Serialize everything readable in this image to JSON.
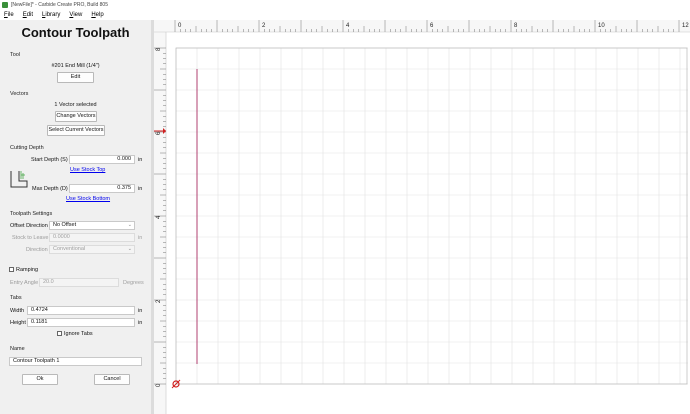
{
  "window": {
    "title": "[NewFile]* - Carbide Create PRO, Build 805"
  },
  "menu": [
    "File",
    "Edit",
    "Library",
    "View",
    "Help"
  ],
  "panel": {
    "heading": "Contour Toolpath",
    "tool": {
      "section": "Tool",
      "name": "#201 End Mill (1/4\")",
      "edit_label": "Edit"
    },
    "vectors": {
      "section": "Vectors",
      "status": "1 Vector selected",
      "change_label": "Change Vectors",
      "select_label": "Select Current Vectors"
    },
    "cutting_depth": {
      "section": "Cutting Depth",
      "start_label": "Start Depth (S)",
      "start_value": "0.000",
      "start_unit": "in",
      "use_stock_top": "Use Stock Top",
      "max_label": "Max Depth (D)",
      "max_value": "0.375",
      "max_unit": "in",
      "use_stock_bottom": "Use Stock Bottom"
    },
    "toolpath_settings": {
      "section": "Toolpath Settings",
      "offset_label": "Offset Direction",
      "offset_value": "No Offset",
      "stock_label": "Stock to Leave",
      "stock_value": "0.0000",
      "stock_unit": "in",
      "direction_label": "Direction",
      "direction_value": "Conventional"
    },
    "ramping": {
      "label": "Ramping",
      "checked": false,
      "entry_label": "Entry Angle",
      "entry_value": "20.0",
      "entry_unit": "Degrees"
    },
    "tabs": {
      "section": "Tabs",
      "width_label": "Width",
      "width_value": "0.4724",
      "width_unit": "in",
      "height_label": "Height",
      "height_value": "0.1181",
      "height_unit": "in",
      "ignore_label": "Ignore Tabs",
      "ignore_checked": false
    },
    "name": {
      "section": "Name",
      "value": "Contour Toolpath 1"
    },
    "ok_label": "Ok",
    "cancel_label": "Cancel"
  },
  "ruler": {
    "x_labels": [
      "0",
      "2",
      "4",
      "6",
      "8",
      "10",
      "12"
    ],
    "y_labels": [
      "8",
      "6",
      "4",
      "2",
      "0"
    ]
  },
  "colors": {
    "vector_line": "#b04070",
    "grid": "#e2e2e2",
    "origin": "#d02020"
  }
}
